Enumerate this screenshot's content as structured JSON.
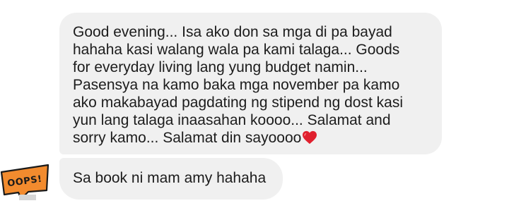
{
  "messages": [
    {
      "lines": [
        "Good evening... Isa ako don sa mga di pa bayad",
        "hahaha kasi walang wala pa kami talaga... Goods",
        "for everyday living lang yung budget namin...",
        "Pasensya na kamo baka mga november pa kamo",
        "ako makabayad pagdating ng stipend ng dost kasi",
        "yun lang talaga inaasahan koooo... Salamat and",
        "sorry kamo... Salamat din sayoooo"
      ],
      "emoji": "red-heart-icon"
    },
    {
      "text": "Sa book ni mam amy hahaha"
    }
  ],
  "avatar": {
    "label": "OOPS!",
    "colors": {
      "fill": "#f28b2e",
      "outline": "#1a1a1a"
    }
  },
  "colors": {
    "bubble": "#f0f0f0",
    "text": "#1c1c1c",
    "heart": "#e0202e"
  }
}
